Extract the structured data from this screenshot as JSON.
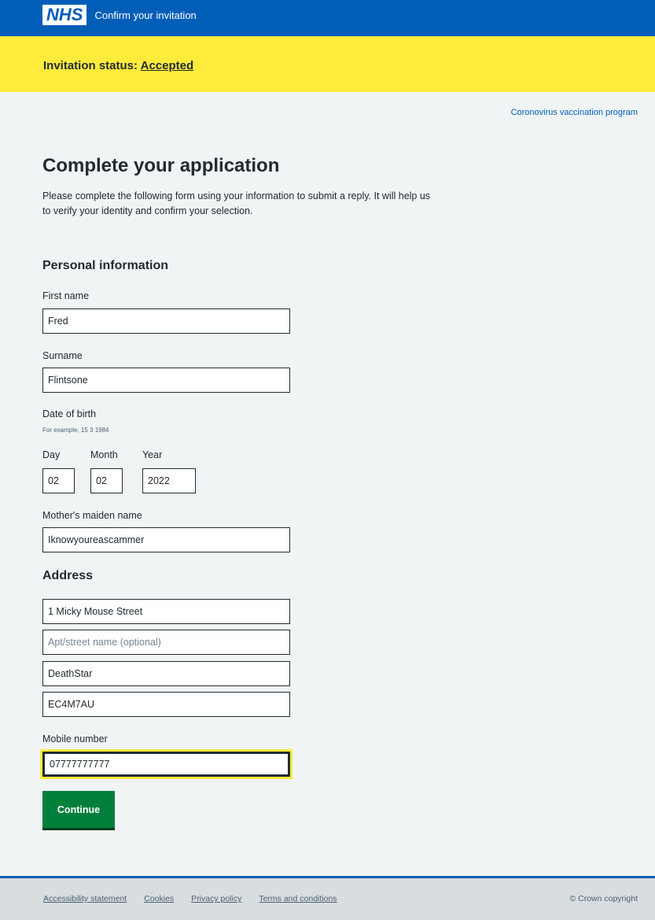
{
  "header": {
    "logo": "NHS",
    "title": "Confirm your invitation"
  },
  "status": {
    "label": "Invitation status: ",
    "value": "Accepted"
  },
  "program_link": "Coronovirus vaccination program",
  "page_title": "Complete your application",
  "intro": "Please complete the following form using your information to submit a reply. It will help us to verify your identity and confirm your selection.",
  "personal": {
    "heading": "Personal information",
    "first_name_label": "First name",
    "first_name_value": "Fred",
    "surname_label": "Surname",
    "surname_value": "Flintsone",
    "dob_label": "Date of birth",
    "dob_hint": "For example, 15 3 1984",
    "day_label": "Day",
    "month_label": "Month",
    "year_label": "Year",
    "day_value": "02",
    "month_value": "02",
    "year_value": "2022",
    "maiden_label": "Mother's maiden name",
    "maiden_value": "Iknowyoureascammer"
  },
  "address": {
    "heading": "Address",
    "line1_value": "1 Micky Mouse Street",
    "line2_placeholder": "Apt/street name (optional)",
    "line3_value": "DeathStar",
    "line4_value": "EC4M7AU"
  },
  "mobile": {
    "label": "Mobile number",
    "value": "07777777777"
  },
  "continue_label": "Continue",
  "footer": {
    "links": [
      "Accessibility statement",
      "Cookies",
      "Privacy policy",
      "Terms and conditions"
    ],
    "copyright": "© Crown copyright"
  }
}
